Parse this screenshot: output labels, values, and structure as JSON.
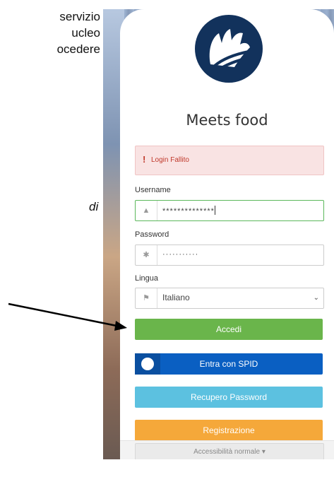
{
  "document": {
    "lines": [
      "servizio",
      "ucleo",
      "ocedere"
    ],
    "italic_fragment": "di"
  },
  "app": {
    "name": "Meets food",
    "alert": "Login Fallito",
    "username_label": "Username",
    "username_value": "**************",
    "password_label": "Password",
    "password_value": "···········",
    "language_label": "Lingua",
    "language_value": "Italiano",
    "login_button": "Accedi",
    "spid_button": "Entra con SPID",
    "recover_button": "Recupero Password",
    "register_button": "Registrazione",
    "accessibility_button": "Accessibilità normale ▾"
  },
  "icons": {
    "alert": "exclamation-icon",
    "username": "user-icon",
    "password": "asterisk-icon",
    "language": "flag-icon",
    "spid": "spid-user-icon",
    "logo": "meets-food-logo"
  },
  "colors": {
    "logo_bg": "#12325c",
    "alert_bg": "#f9e3e3",
    "alert_text": "#c0392b",
    "accedi": "#6ab54b",
    "spid": "#0a5fc2",
    "recupero": "#5cc1e0",
    "registrazione": "#f5a83a"
  }
}
